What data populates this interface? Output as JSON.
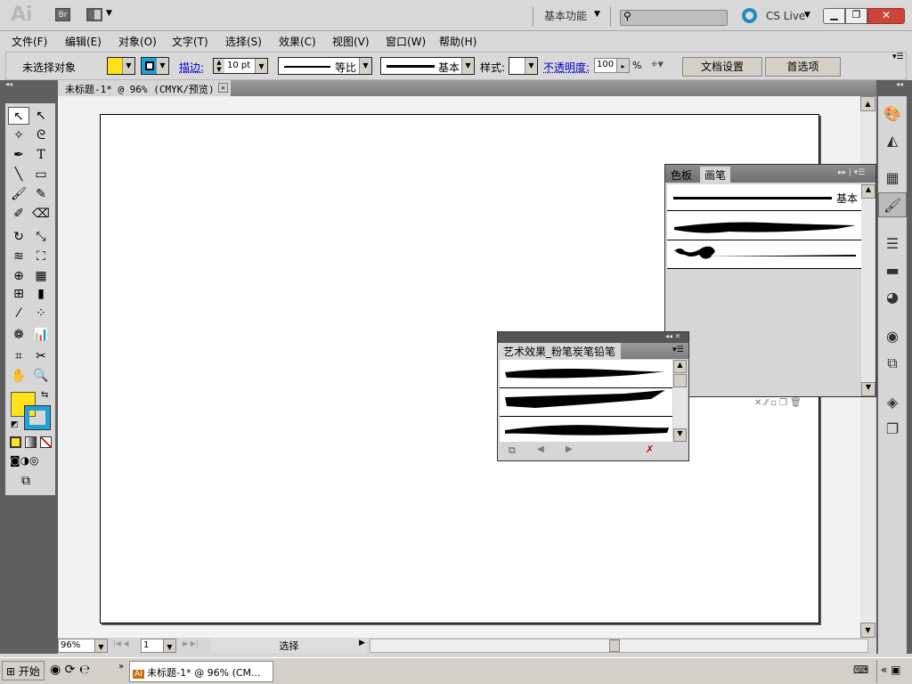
{
  "app": {
    "logo": "Ai",
    "bridge": "Br",
    "workspace": "基本功能",
    "search_placeholder": "",
    "cslive": "CS Live"
  },
  "menu": [
    "文件(F)",
    "编辑(E)",
    "对象(O)",
    "文字(T)",
    "选择(S)",
    "效果(C)",
    "视图(V)",
    "窗口(W)",
    "帮助(H)"
  ],
  "control": {
    "selection": "未选择对象",
    "stroke_label": "描边:",
    "stroke_value": "10 pt",
    "profile": "等比",
    "brush": "基本",
    "style_label": "样式:",
    "opacity_label": "不透明度:",
    "opacity_value": "100",
    "percent": "%",
    "doc_setup": "文档设置",
    "preferences": "首选项"
  },
  "document": {
    "tab": "未标题-1* @ 96% (CMYK/预览)"
  },
  "brush_panel": {
    "tabs": [
      "色板",
      "画笔"
    ],
    "basic_label": "基本"
  },
  "art_panel": {
    "title": "艺术效果_粉笔炭笔铅笔"
  },
  "status": {
    "zoom": "96%",
    "page": "1",
    "mode": "选择"
  },
  "taskbar": {
    "start": "开始",
    "task": "未标题-1* @ 96% (CM..."
  },
  "colors": {
    "fill": "#ffe21a",
    "stroke": "#1fa0d8",
    "accent": "#0000cc"
  }
}
